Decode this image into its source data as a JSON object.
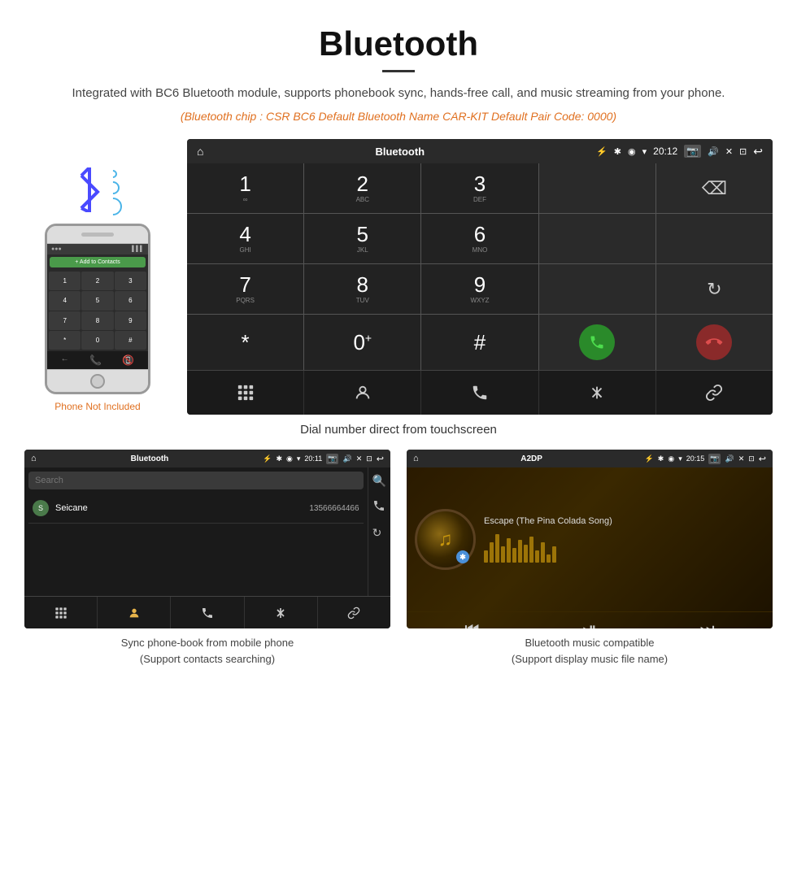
{
  "header": {
    "title": "Bluetooth",
    "description": "Integrated with BC6 Bluetooth module, supports phonebook sync, hands-free call, and music streaming from your phone.",
    "specs": "(Bluetooth chip : CSR BC6    Default Bluetooth Name CAR-KIT    Default Pair Code: 0000)"
  },
  "phone_label": "Phone Not Included",
  "main_caption": "Dial number direct from touchscreen",
  "car_screen": {
    "status_bar": {
      "home": "⌂",
      "title": "Bluetooth",
      "usb": "⚡",
      "time": "20:12",
      "icons": "🔵 📍 📶"
    },
    "dialpad": [
      {
        "num": "1",
        "letters": "∞",
        "row": 0,
        "col": 0
      },
      {
        "num": "2",
        "letters": "ABC",
        "row": 0,
        "col": 1
      },
      {
        "num": "3",
        "letters": "DEF",
        "row": 0,
        "col": 2
      },
      {
        "num": "4",
        "letters": "GHI",
        "row": 1,
        "col": 0
      },
      {
        "num": "5",
        "letters": "JKL",
        "row": 1,
        "col": 1
      },
      {
        "num": "6",
        "letters": "MNO",
        "row": 1,
        "col": 2
      },
      {
        "num": "7",
        "letters": "PQRS",
        "row": 2,
        "col": 0
      },
      {
        "num": "8",
        "letters": "TUV",
        "row": 2,
        "col": 1
      },
      {
        "num": "9",
        "letters": "WXYZ",
        "row": 2,
        "col": 2
      },
      {
        "num": "*",
        "letters": "",
        "row": 3,
        "col": 0
      },
      {
        "num": "0+",
        "letters": "",
        "row": 3,
        "col": 1
      },
      {
        "num": "#",
        "letters": "",
        "row": 3,
        "col": 2
      }
    ],
    "nav_items": [
      "⠿",
      "👤",
      "📞",
      "✱",
      "🔗"
    ]
  },
  "phonebook_screen": {
    "status_bar_title": "Bluetooth",
    "search_placeholder": "Search",
    "contact": {
      "initial": "S",
      "name": "Seicane",
      "number": "13566664466"
    },
    "right_icons": [
      "🔍",
      "📞",
      "🔄"
    ],
    "nav_items": [
      "⠿",
      "👤",
      "📞",
      "✱",
      "🔗"
    ],
    "caption_line1": "Sync phone-book from mobile phone",
    "caption_line2": "(Support contacts searching)"
  },
  "music_screen": {
    "status_bar_title": "A2DP",
    "time": "20:15",
    "song_title": "Escape (The Pina Colada Song)",
    "viz_heights": [
      15,
      25,
      35,
      20,
      30,
      18,
      28,
      22,
      32,
      15,
      25,
      10,
      20
    ],
    "controls": [
      "⏮",
      "⏯",
      "⏭"
    ],
    "caption_line1": "Bluetooth music compatible",
    "caption_line2": "(Support display music file name)"
  }
}
